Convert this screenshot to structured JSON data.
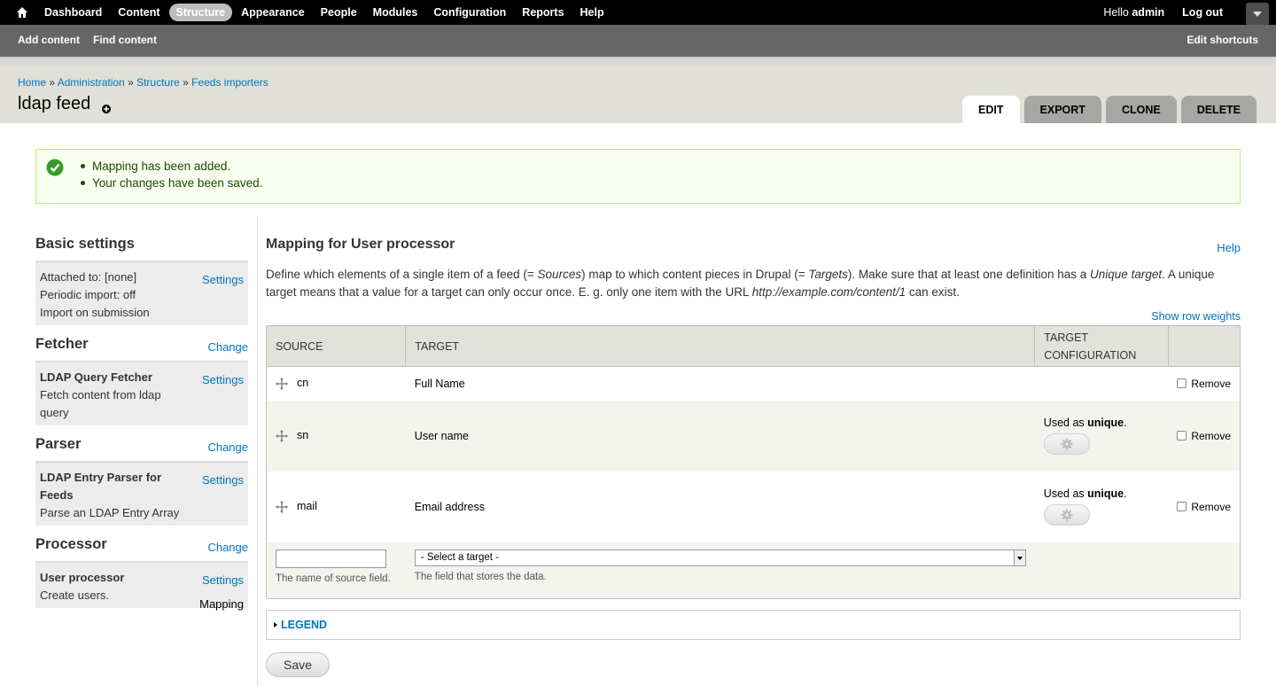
{
  "toolbar": {
    "menu": [
      {
        "label": "Dashboard"
      },
      {
        "label": "Content"
      },
      {
        "label": "Structure"
      },
      {
        "label": "Appearance"
      },
      {
        "label": "People"
      },
      {
        "label": "Modules"
      },
      {
        "label": "Configuration"
      },
      {
        "label": "Reports"
      },
      {
        "label": "Help"
      }
    ],
    "hello": "Hello",
    "username": "admin",
    "logout": "Log out"
  },
  "shortcuts": {
    "links": [
      "Add content",
      "Find content"
    ],
    "edit": "Edit shortcuts"
  },
  "breadcrumb": [
    "Home",
    "Administration",
    "Structure",
    "Feeds importers"
  ],
  "page_title": "ldap feed",
  "tabs": [
    "Edit",
    "Export",
    "Clone",
    "Delete"
  ],
  "messages": [
    "Mapping has been added.",
    "Your changes have been saved."
  ],
  "left": {
    "basic": {
      "heading": "Basic settings",
      "lines": [
        "Attached to: [none]",
        "Periodic import: off",
        "Import on submission"
      ],
      "settings": "Settings"
    },
    "fetcher": {
      "heading": "Fetcher",
      "change": "Change",
      "name": "LDAP Query Fetcher",
      "desc": "Fetch content from ldap query",
      "settings": "Settings"
    },
    "parser": {
      "heading": "Parser",
      "change": "Change",
      "name": "LDAP Entry Parser for Feeds",
      "desc": "Parse an LDAP Entry Array",
      "settings": "Settings"
    },
    "processor": {
      "heading": "Processor",
      "change": "Change",
      "name": "User processor",
      "desc": "Create users.",
      "settings": "Settings",
      "mapping": "Mapping"
    }
  },
  "main": {
    "heading": "Mapping for User processor",
    "help": "Help",
    "desc_1": "Define which elements of a single item of a feed (= ",
    "desc_sources": "Sources",
    "desc_2": ") map to which content pieces in Drupal (= ",
    "desc_targets": "Targets",
    "desc_3": "). Make sure that at least one definition has a ",
    "desc_unique": "Unique target",
    "desc_4": ". A unique target means that a value for a target can only occur once. E. g. only one item with the URL ",
    "desc_url": "http://example.com/content/1",
    "desc_5": " can exist.",
    "show_row_weights": "Show row weights",
    "columns": [
      "Source",
      "Target",
      "Target configuration",
      ""
    ],
    "rows": [
      {
        "source": "cn",
        "target": "Full Name",
        "unique_prefix": "",
        "unique_word": "",
        "remove": "Remove"
      },
      {
        "source": "sn",
        "target": "User name",
        "unique_prefix": "Used as ",
        "unique_word": "unique",
        "remove": "Remove"
      },
      {
        "source": "mail",
        "target": "Email address",
        "unique_prefix": "Used as ",
        "unique_word": "unique",
        "remove": "Remove"
      }
    ],
    "source_hint": "The name of source field.",
    "select_value": "- Select a target -",
    "target_hint": "The field that stores the data.",
    "legend": "Legend",
    "save": "Save"
  }
}
